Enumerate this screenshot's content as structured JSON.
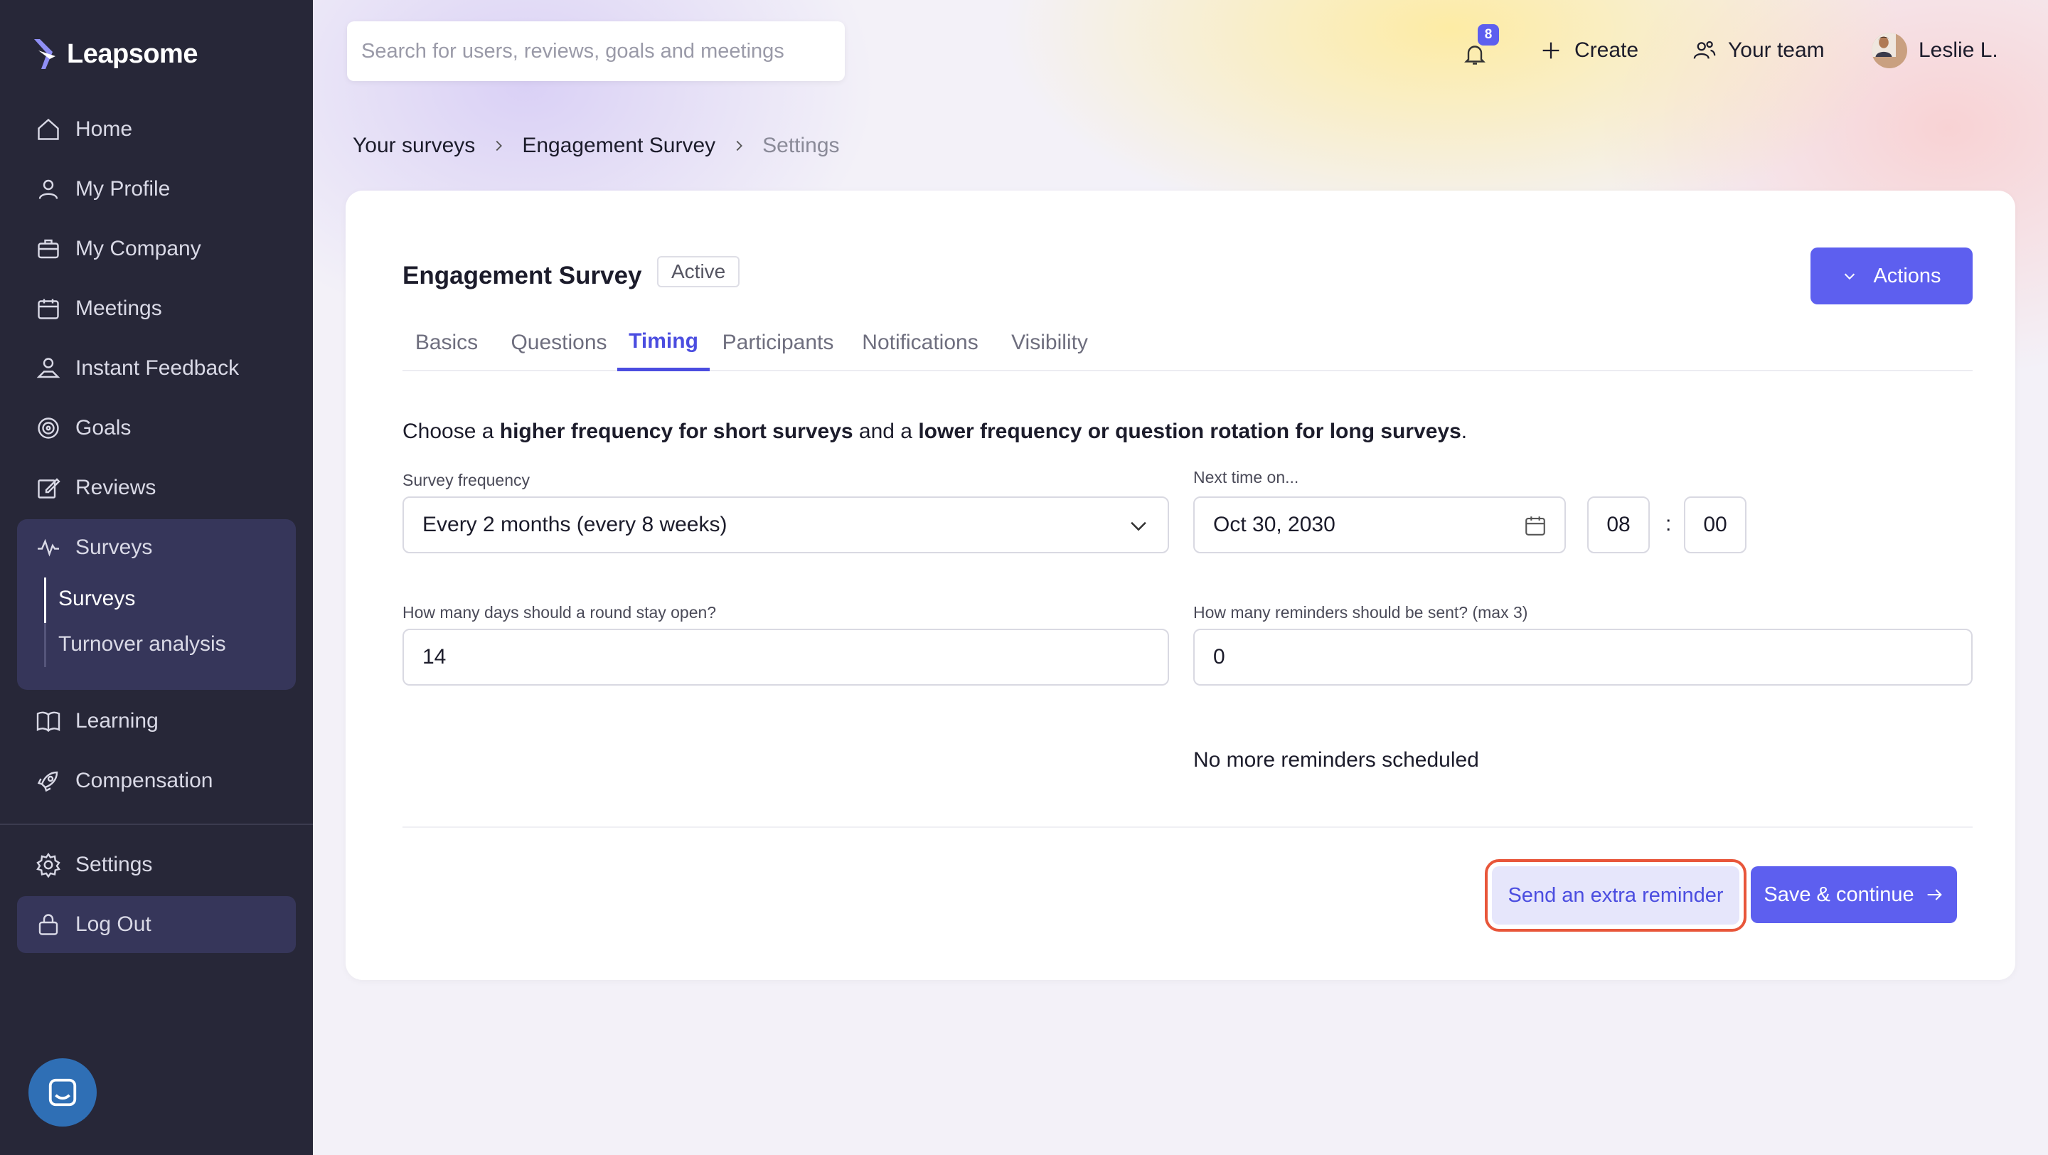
{
  "brand": {
    "name": "Leapsome"
  },
  "sidebar": {
    "items": [
      {
        "label": "Home",
        "icon": "home-icon"
      },
      {
        "label": "My Profile",
        "icon": "user-icon"
      },
      {
        "label": "My Company",
        "icon": "briefcase-icon"
      },
      {
        "label": "Meetings",
        "icon": "calendar-icon"
      },
      {
        "label": "Instant Feedback",
        "icon": "feedback-icon"
      },
      {
        "label": "Goals",
        "icon": "target-icon"
      },
      {
        "label": "Reviews",
        "icon": "edit-icon"
      },
      {
        "label": "Surveys",
        "icon": "pulse-icon"
      },
      {
        "label": "Learning",
        "icon": "book-icon"
      },
      {
        "label": "Compensation",
        "icon": "rocket-icon"
      },
      {
        "label": "Settings",
        "icon": "gear-icon"
      },
      {
        "label": "Log Out",
        "icon": "lock-icon"
      }
    ],
    "surveys_sub": [
      {
        "label": "Surveys",
        "active": true
      },
      {
        "label": "Turnover analysis",
        "active": false
      }
    ]
  },
  "topbar": {
    "search_placeholder": "Search for users, reviews, goals and meetings",
    "notifications_count": "8",
    "create_label": "Create",
    "team_label": "Your team",
    "user_name": "Leslie L."
  },
  "breadcrumb": [
    "Your surveys",
    "Engagement Survey",
    "Settings"
  ],
  "survey": {
    "title": "Engagement Survey",
    "status": "Active",
    "actions_label": "Actions",
    "tabs": [
      "Basics",
      "Questions",
      "Timing",
      "Participants",
      "Notifications",
      "Visibility"
    ],
    "active_tab": "Timing"
  },
  "timing": {
    "intro": {
      "p1": "Choose a ",
      "b1": "higher frequency for short surveys",
      "p2": " and a ",
      "b2": "lower frequency or question rotation for long surveys",
      "p3": "."
    },
    "frequency_label": "Survey frequency",
    "frequency_value": "Every 2 months (every 8 weeks)",
    "next_time_label": "Next time on...",
    "next_date": "Oct 30, 2030",
    "hour": "08",
    "minute": "00",
    "time_separator": ":",
    "days_open_label": "How many days should a round stay open?",
    "days_open_value": "14",
    "reminders_label": "How many reminders should be sent? (max 3)",
    "reminders_value": "0",
    "reminders_note": "No more reminders scheduled"
  },
  "footer": {
    "extra_reminder_label": "Send an extra reminder",
    "save_label": "Save & continue"
  },
  "colors": {
    "sidebar_bg": "#272738",
    "accent": "#5d5fef",
    "highlight_outline": "#e8563a"
  }
}
